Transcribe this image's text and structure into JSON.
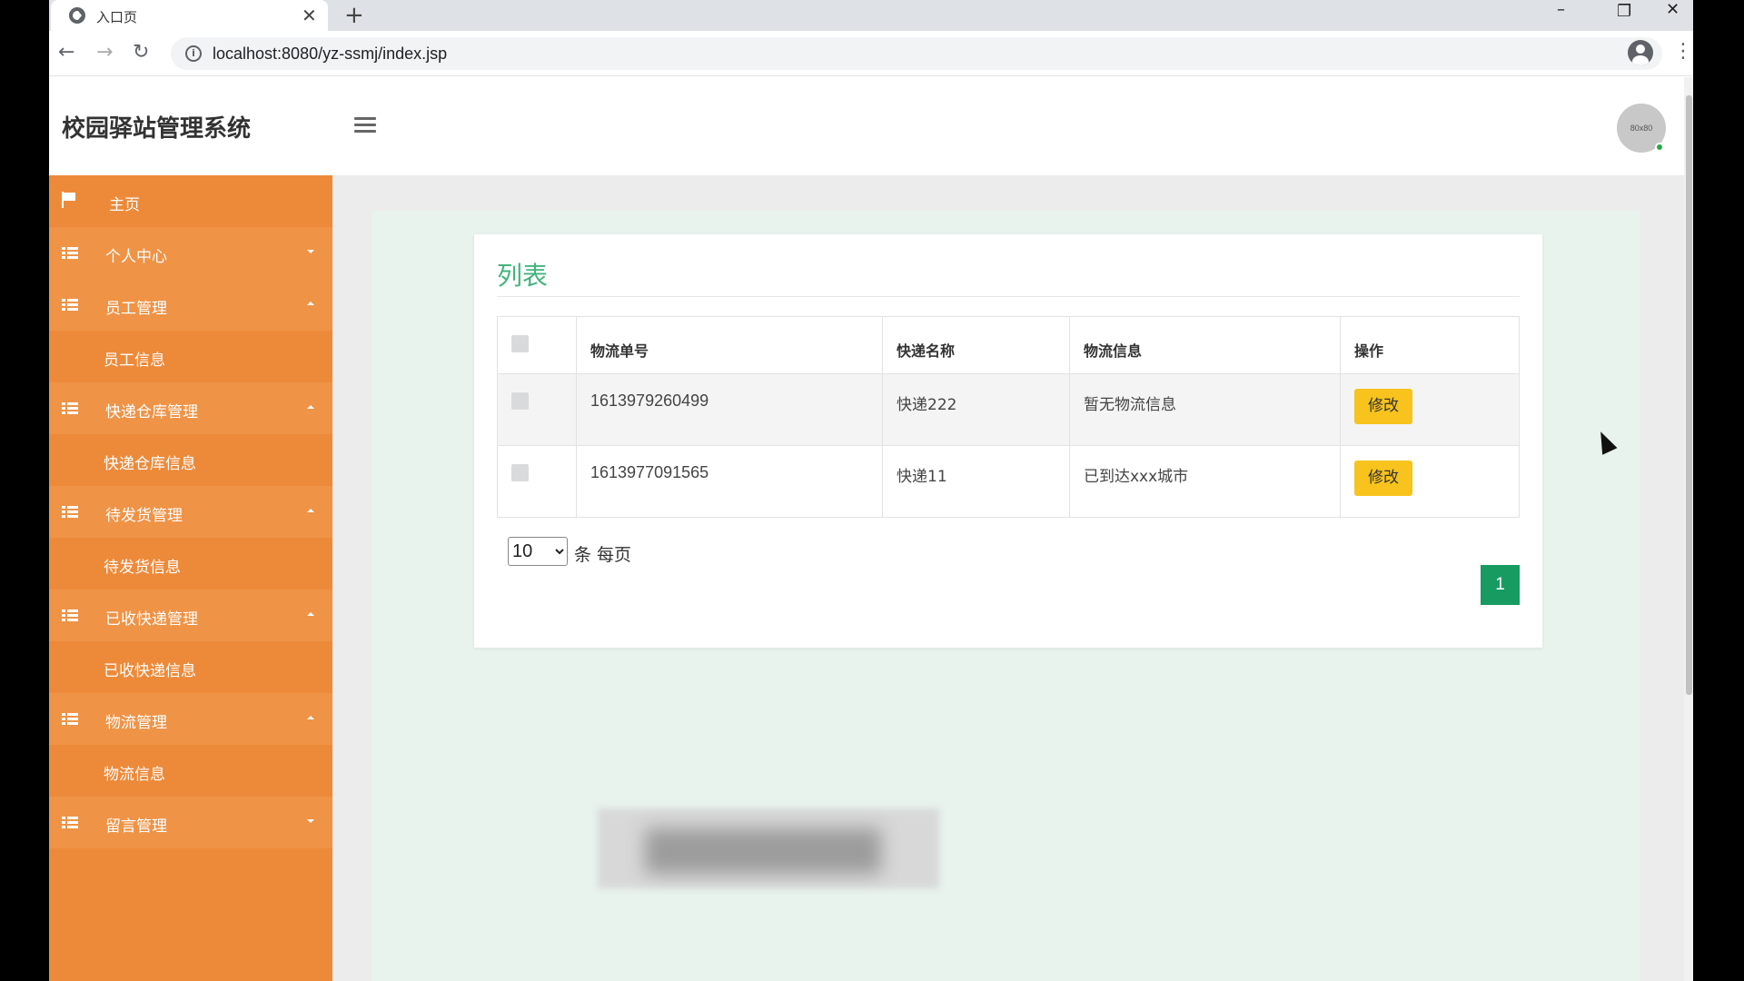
{
  "browser": {
    "tab_title": "入口页",
    "url": "localhost:8080/yz-ssmj/index.jsp"
  },
  "app": {
    "title": "校园驿站管理系统",
    "avatar_text": "80x80"
  },
  "sidebar": {
    "items": [
      {
        "label": "主页",
        "kind": "home"
      },
      {
        "label": "个人中心",
        "kind": "parent",
        "expanded": false
      },
      {
        "label": "员工管理",
        "kind": "parent",
        "expanded": true
      },
      {
        "label": "员工信息",
        "kind": "sub"
      },
      {
        "label": "快递仓库管理",
        "kind": "parent",
        "expanded": true
      },
      {
        "label": "快递仓库信息",
        "kind": "sub"
      },
      {
        "label": "待发货管理",
        "kind": "parent",
        "expanded": true
      },
      {
        "label": "待发货信息",
        "kind": "sub"
      },
      {
        "label": "已收快递管理",
        "kind": "parent",
        "expanded": true
      },
      {
        "label": "已收快递信息",
        "kind": "sub"
      },
      {
        "label": "物流管理",
        "kind": "parent",
        "expanded": true
      },
      {
        "label": "物流信息",
        "kind": "sub"
      },
      {
        "label": "留言管理",
        "kind": "parent",
        "expanded": false
      }
    ]
  },
  "main": {
    "card_title": "列表",
    "table": {
      "headers": [
        "物流单号",
        "快递名称",
        "物流信息",
        "操作"
      ],
      "rows": [
        {
          "order_no": "1613979260499",
          "courier": "快递222",
          "info": "暂无物流信息",
          "action": "修改"
        },
        {
          "order_no": "1613977091565",
          "courier": "快递11",
          "info": "已到达xxx城市",
          "action": "修改"
        }
      ]
    },
    "pagination": {
      "page_size": "10",
      "page_size_label": "条 每页",
      "current_page": "1"
    }
  },
  "colors": {
    "sidebar": "#ed8a3a",
    "accent_green": "#44b37c",
    "page_button": "#189b61",
    "edit_button": "#f7c31c"
  }
}
